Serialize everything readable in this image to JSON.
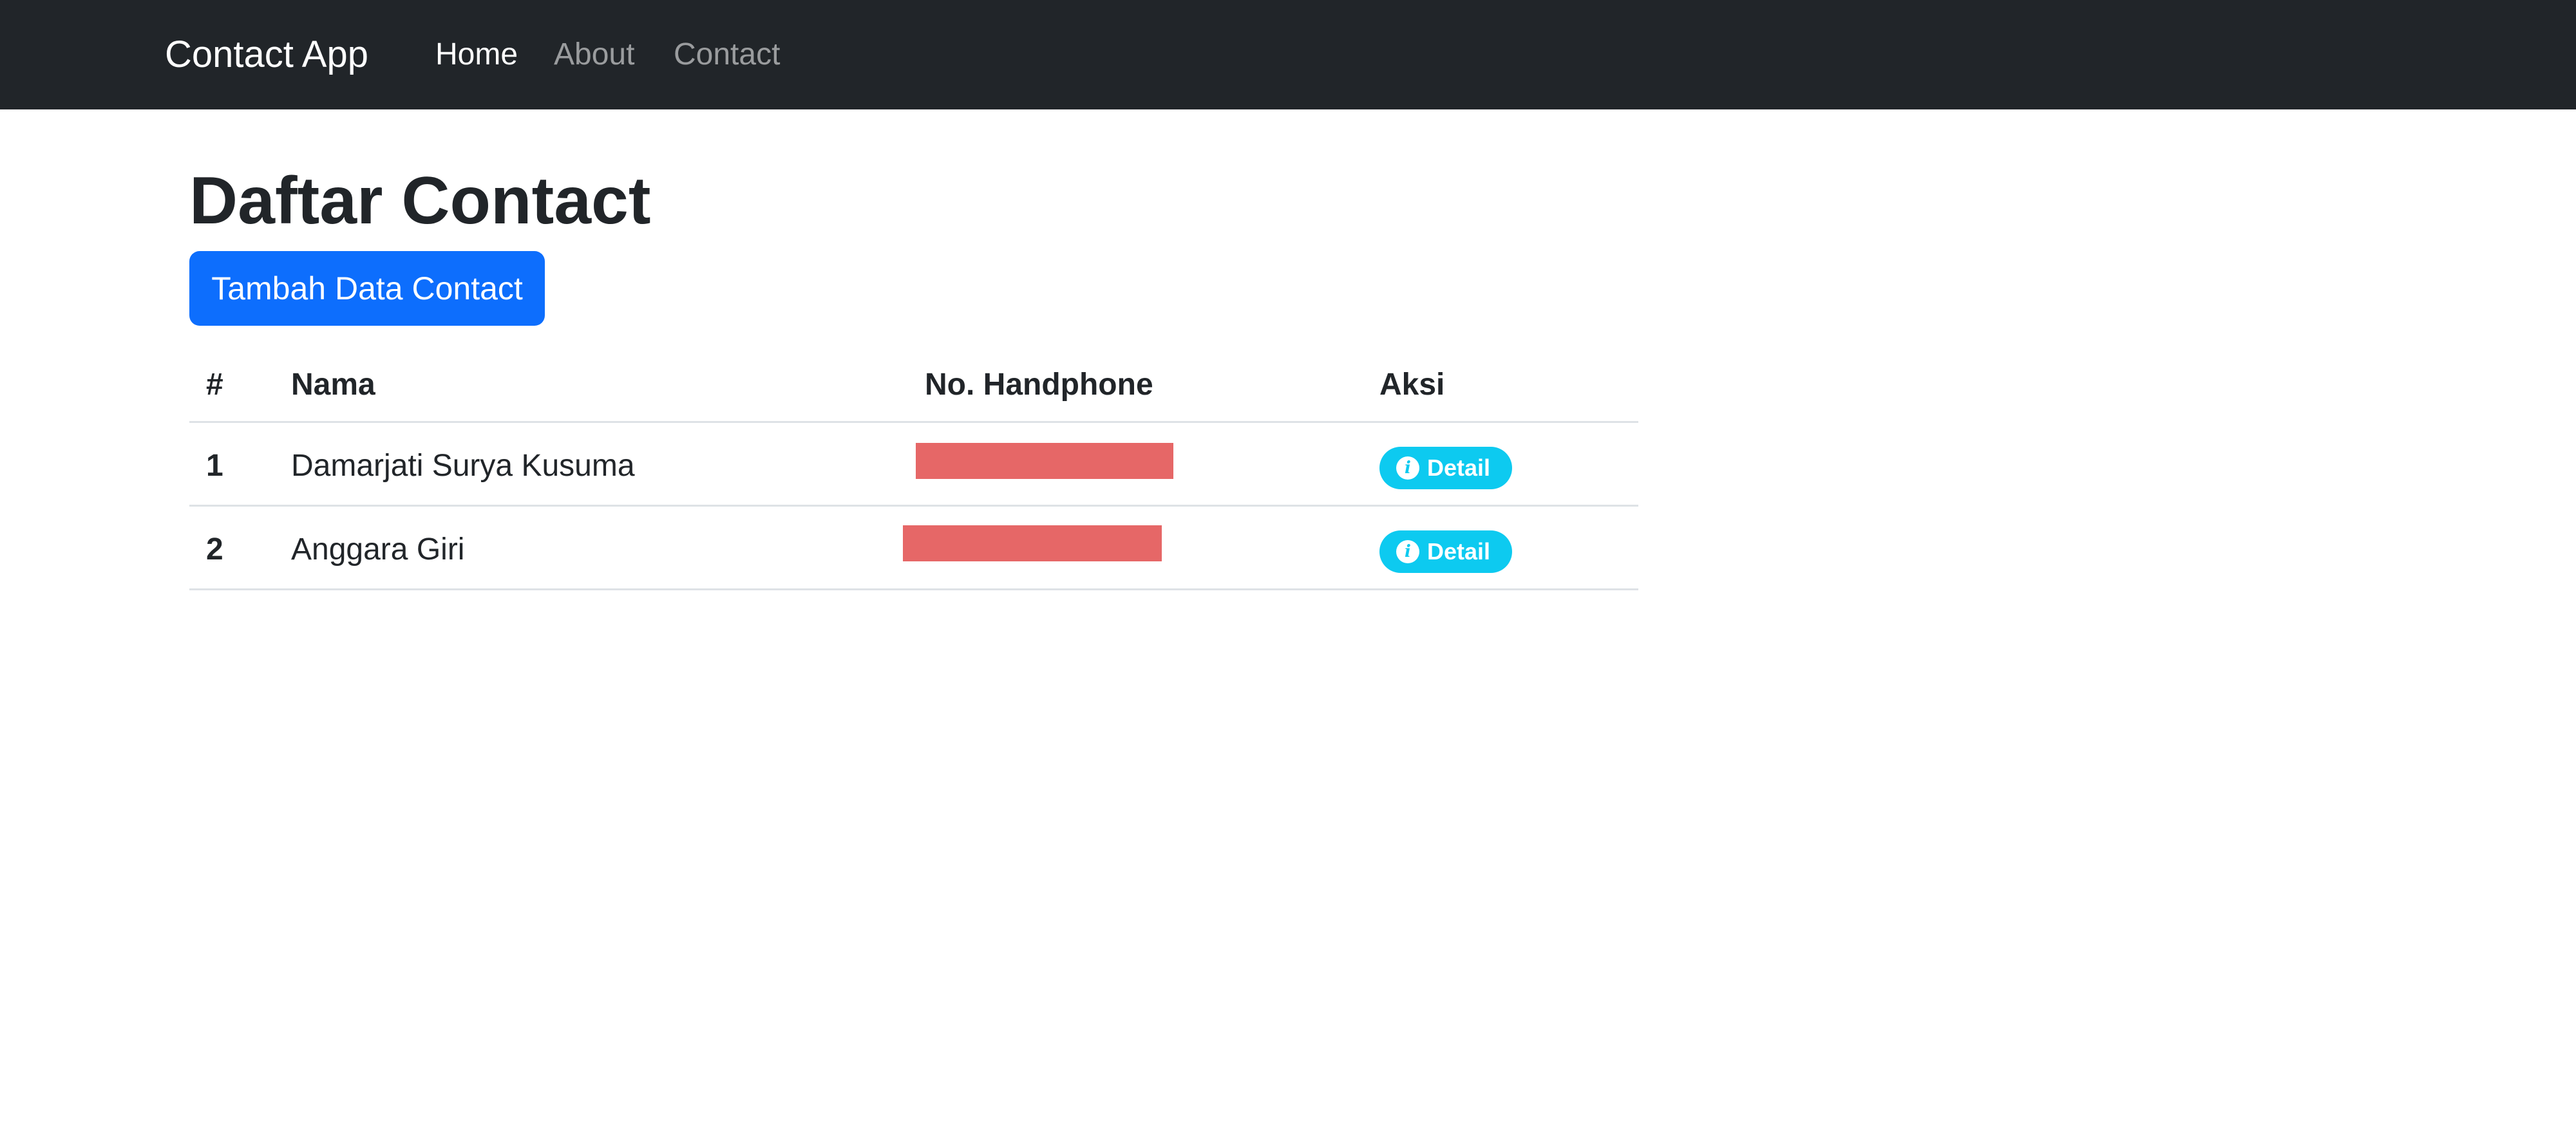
{
  "navbar": {
    "brand": "Contact App",
    "links": [
      {
        "label": "Home",
        "active": true
      },
      {
        "label": "About",
        "active": false
      },
      {
        "label": "Contact",
        "active": false
      }
    ]
  },
  "page": {
    "title": "Daftar Contact",
    "add_button_label": "Tambah Data Contact"
  },
  "table": {
    "headers": [
      "#",
      "Nama",
      "No. Handphone",
      "Aksi"
    ],
    "rows": [
      {
        "no": "1",
        "name": "Damarjati Surya Kusuma",
        "phone": "",
        "action_label": "Detail"
      },
      {
        "no": "2",
        "name": "Anggara Giri",
        "phone": "",
        "action_label": "Detail"
      }
    ]
  },
  "icons": {
    "detail_icon": "info-circle-icon"
  },
  "colors": {
    "navbar_bg": "#212529",
    "primary": "#0d6efd",
    "info": "#0dcaf0",
    "redaction": "#e66767"
  }
}
